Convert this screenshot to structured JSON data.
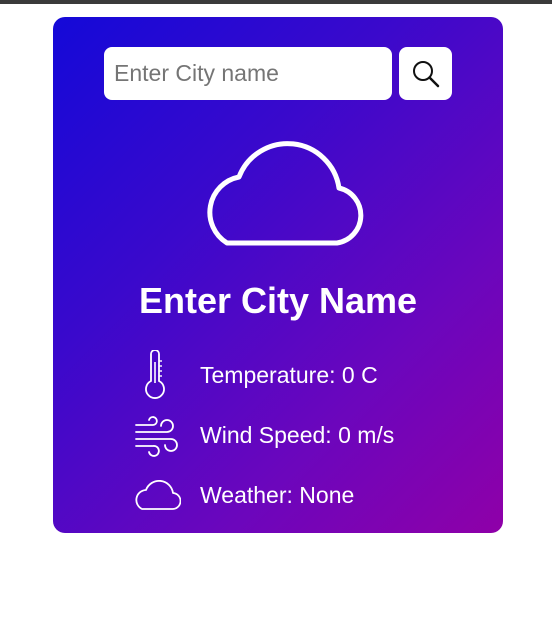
{
  "search": {
    "placeholder": "Enter City name",
    "value": "",
    "button_icon": "search-icon"
  },
  "weather_icon": "cloud-icon",
  "city_name": "Enter City Name",
  "details": {
    "temperature": {
      "icon": "thermometer-icon",
      "label": "Temperature:",
      "value": "0 C",
      "text": "Temperature: 0 C"
    },
    "wind": {
      "icon": "wind-icon",
      "label": "Wind Speed:",
      "value": "0 m/s",
      "text": "Wind Speed: 0 m/s"
    },
    "weather": {
      "icon": "cloud-small-icon",
      "label": "Weather:",
      "value": "None",
      "text": "Weather: None"
    }
  },
  "colors": {
    "gradient_start": "#1409d8",
    "gradient_end": "#8f00a8",
    "text": "#ffffff"
  }
}
